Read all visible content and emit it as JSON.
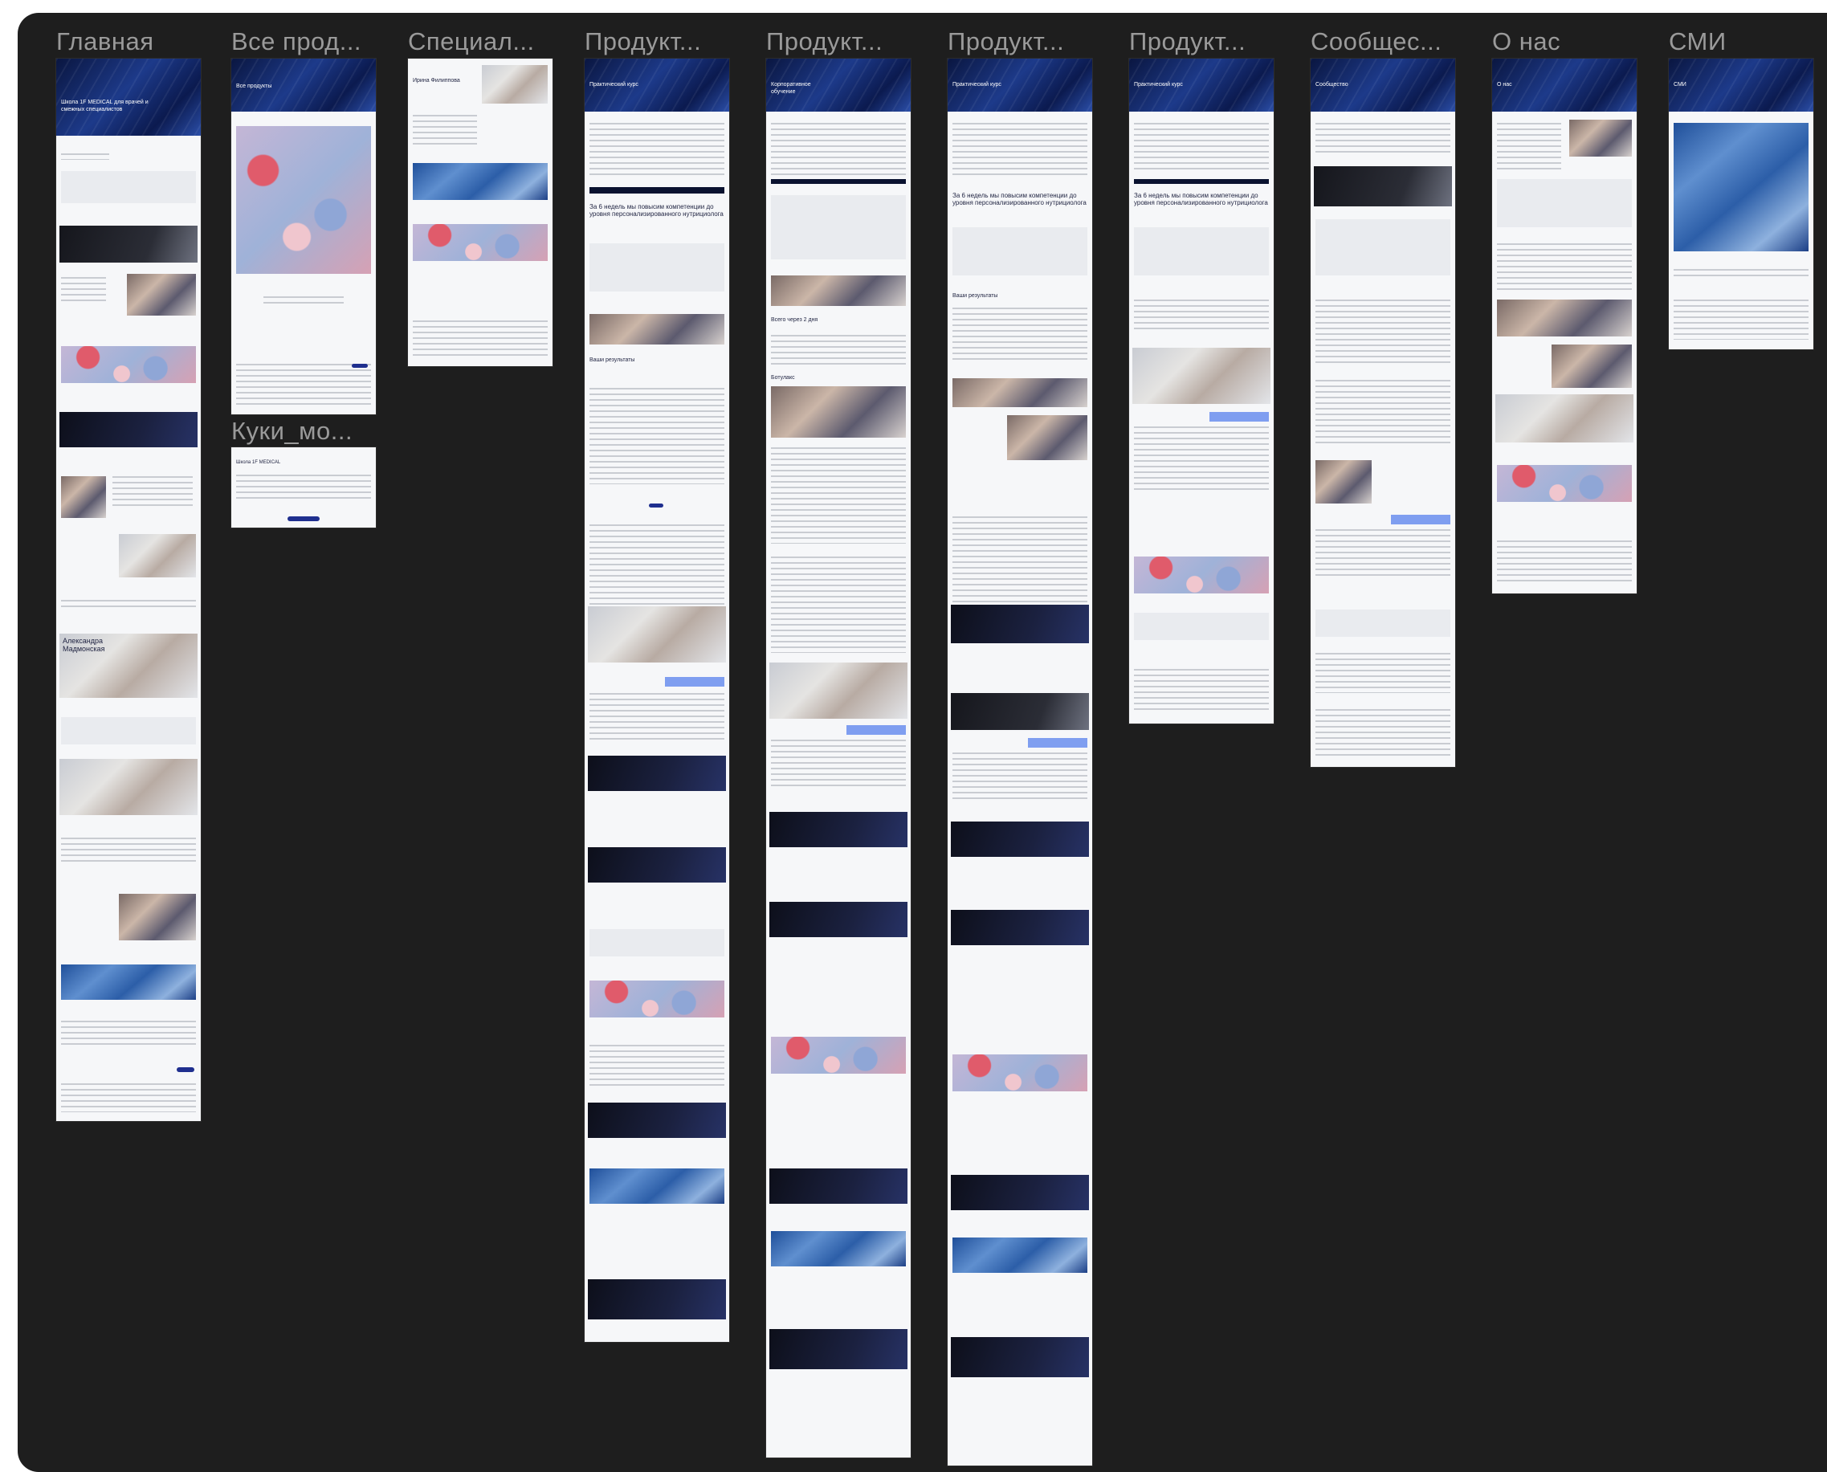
{
  "frames": [
    {
      "id": "home",
      "title": "Главная"
    },
    {
      "id": "all-products",
      "title": "Все прод..."
    },
    {
      "id": "specialists",
      "title": "Специал..."
    },
    {
      "id": "product-1",
      "title": "Продукт..."
    },
    {
      "id": "product-2",
      "title": "Продукт..."
    },
    {
      "id": "product-3",
      "title": "Продукт..."
    },
    {
      "id": "product-4",
      "title": "Продукт..."
    },
    {
      "id": "community",
      "title": "Сообщес..."
    },
    {
      "id": "about",
      "title": "О нас"
    },
    {
      "id": "media",
      "title": "СМИ"
    },
    {
      "id": "cookies",
      "title": "Куки_мо..."
    }
  ],
  "texts": {
    "home_hero": "Школа 1F MEDICAL для врачей и смежных специалистов",
    "home_name": "Александра Мадмонская",
    "allproducts_hero": "Все продукты",
    "specialists_name": "Ирина Филиппова",
    "product1_hero": "Практический курс",
    "product2_hero": "Корпоративное обучение",
    "product3_hero": "Практический курс",
    "product4_hero": "Практический курс",
    "community_hero": "Сообщество",
    "about_hero": "О нас",
    "media_hero": "СМИ",
    "cookies_title": "Школа 1F MEDICAL",
    "big_heading": "За 6 недель мы повысим компетенции до уровня персонализированного нутрициолога",
    "results": "Ваши результаты",
    "total": "Всего через 2 дня",
    "botox": "Ботулакс"
  },
  "colors": {
    "canvas": "#1e1e1e",
    "frame_title": "#9a9a9a",
    "brand_navy": "#1f2f8f",
    "accent_blue": "#7f9ef0"
  }
}
